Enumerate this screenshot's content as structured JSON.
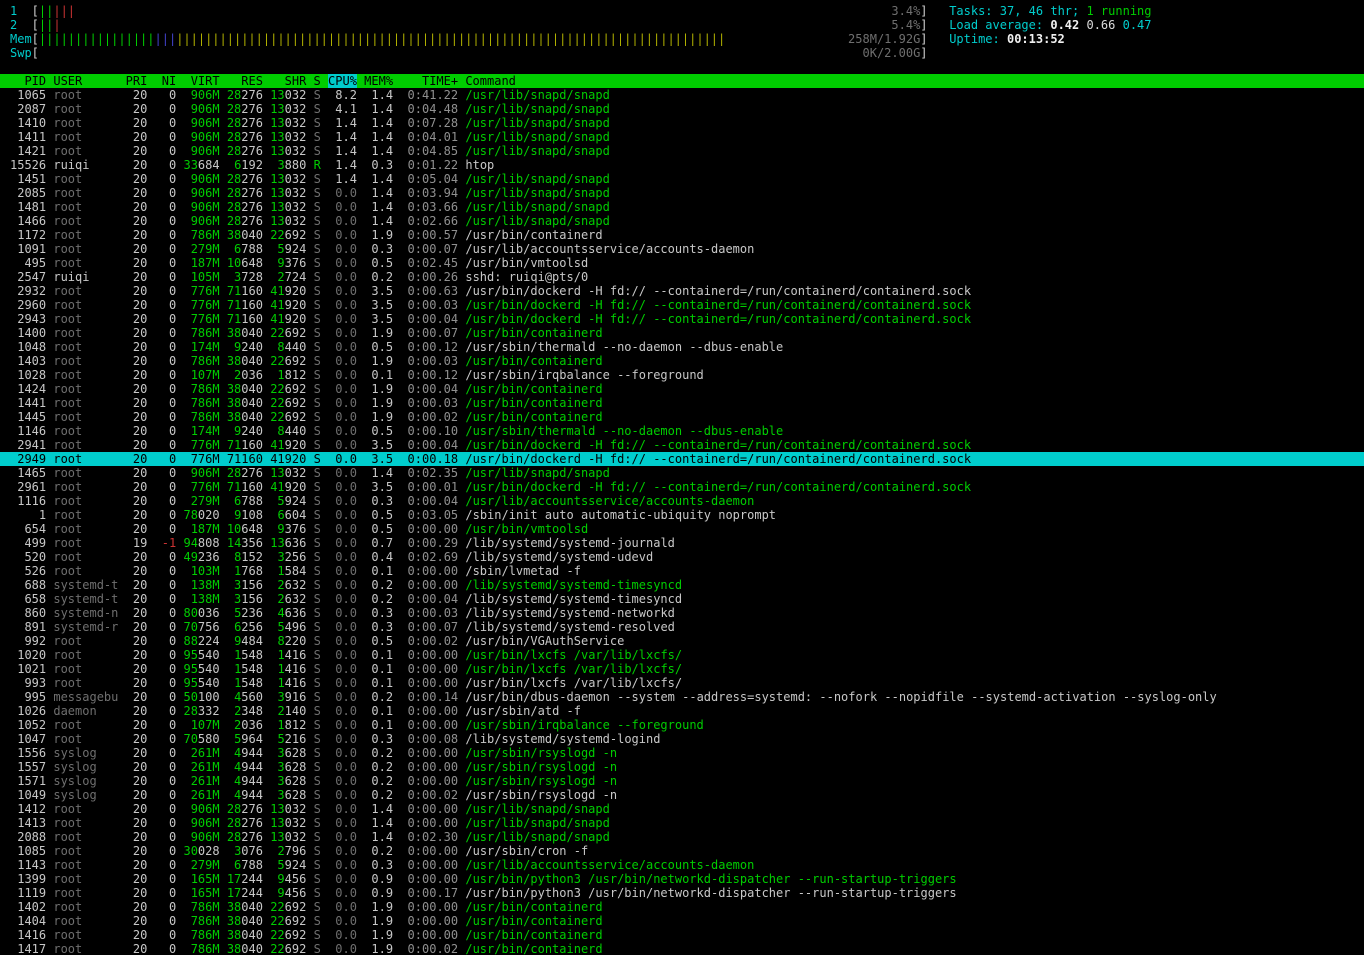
{
  "current_user": "ruiqi",
  "colors": {
    "green": "#00cd00",
    "cyan": "#00cdcd",
    "red": "#cc3333",
    "blue": "#4242cd",
    "yellow": "#b0b000",
    "norm": "#c8c8c8",
    "dim": "#6f6f6f",
    "time": "#909090",
    "meter_value": "#6f6f6f",
    "header_bg": "#00cd00",
    "selection_bg": "#00cdcd",
    "bright": "#f0f0f0",
    "white": "#dcdcdc"
  },
  "meters": {
    "bracket_open": "[",
    "bracket_close": "]",
    "cpu1": {
      "caption": "1",
      "value": "3.4%",
      "segments": [
        {
          "color": "#00cd00",
          "count": 2
        },
        {
          "color": "#cc3333",
          "count": 3
        }
      ]
    },
    "cpu2": {
      "caption": "2",
      "value": "5.4%",
      "segments": [
        {
          "color": "#00cd00",
          "count": 2
        },
        {
          "color": "#cc3333",
          "count": 1
        }
      ]
    },
    "mem": {
      "caption": "Mem",
      "value": "258M/1.92G",
      "segments": [
        {
          "color": "#00cd00",
          "count": 16
        },
        {
          "color": "#4242cd",
          "count": 3
        },
        {
          "color": "#b0b000",
          "count": 76
        }
      ]
    },
    "swp": {
      "caption": "Swp",
      "value": "0K/2.00G",
      "segments": []
    }
  },
  "summary": {
    "tasks_label": "Tasks: ",
    "tasks_value": "37, 46 thr; ",
    "tasks_running": "1 running",
    "load_label": "Load average: ",
    "load_1": "0.42 ",
    "load_5": "0.66 ",
    "load_15": "0.47",
    "uptime_label": "Uptime: ",
    "uptime_value": "00:13:52"
  },
  "table": {
    "sort_key": "cpu",
    "selected_pid": 2949,
    "columns": [
      {
        "key": "pid",
        "label": "PID",
        "width": 5,
        "align": "right"
      },
      {
        "key": "user",
        "label": "USER",
        "width": 9,
        "align": "left"
      },
      {
        "key": "pri",
        "label": "PRI",
        "width": 3,
        "align": "right"
      },
      {
        "key": "ni",
        "label": "NI",
        "width": 3,
        "align": "right"
      },
      {
        "key": "virt",
        "label": "VIRT",
        "width": 5,
        "align": "right"
      },
      {
        "key": "res",
        "label": "RES",
        "width": 5,
        "align": "right"
      },
      {
        "key": "shr",
        "label": "SHR",
        "width": 5,
        "align": "right"
      },
      {
        "key": "s",
        "label": "S",
        "width": 1,
        "align": "left"
      },
      {
        "key": "cpu",
        "label": "CPU%",
        "width": 4,
        "align": "right"
      },
      {
        "key": "mem",
        "label": "MEM%",
        "width": 4,
        "align": "right"
      },
      {
        "key": "time",
        "label": "TIME+",
        "width": 8,
        "align": "right"
      },
      {
        "key": "command",
        "label": "Command",
        "width": 0,
        "align": "left"
      }
    ],
    "processes": [
      [
        1065,
        "root",
        "20",
        "0",
        "906M",
        "28276",
        "13032",
        "S",
        "8.2",
        "1.4",
        "0:41.22",
        "/usr/lib/snapd/snapd",
        1
      ],
      [
        2087,
        "root",
        "20",
        "0",
        "906M",
        "28276",
        "13032",
        "S",
        "4.1",
        "1.4",
        "0:04.48",
        "/usr/lib/snapd/snapd",
        1
      ],
      [
        1410,
        "root",
        "20",
        "0",
        "906M",
        "28276",
        "13032",
        "S",
        "1.4",
        "1.4",
        "0:07.28",
        "/usr/lib/snapd/snapd",
        1
      ],
      [
        1411,
        "root",
        "20",
        "0",
        "906M",
        "28276",
        "13032",
        "S",
        "1.4",
        "1.4",
        "0:04.01",
        "/usr/lib/snapd/snapd",
        1
      ],
      [
        1421,
        "root",
        "20",
        "0",
        "906M",
        "28276",
        "13032",
        "S",
        "1.4",
        "1.4",
        "0:04.85",
        "/usr/lib/snapd/snapd",
        1
      ],
      [
        15526,
        "ruiqi",
        "20",
        "0",
        "33684",
        "6192",
        "3880",
        "R",
        "1.4",
        "0.3",
        "0:01.22",
        "htop",
        0
      ],
      [
        1451,
        "root",
        "20",
        "0",
        "906M",
        "28276",
        "13032",
        "S",
        "1.4",
        "1.4",
        "0:05.04",
        "/usr/lib/snapd/snapd",
        1
      ],
      [
        2085,
        "root",
        "20",
        "0",
        "906M",
        "28276",
        "13032",
        "S",
        "0.0",
        "1.4",
        "0:03.94",
        "/usr/lib/snapd/snapd",
        1
      ],
      [
        1481,
        "root",
        "20",
        "0",
        "906M",
        "28276",
        "13032",
        "S",
        "0.0",
        "1.4",
        "0:03.66",
        "/usr/lib/snapd/snapd",
        1
      ],
      [
        1466,
        "root",
        "20",
        "0",
        "906M",
        "28276",
        "13032",
        "S",
        "0.0",
        "1.4",
        "0:02.66",
        "/usr/lib/snapd/snapd",
        1
      ],
      [
        1172,
        "root",
        "20",
        "0",
        "786M",
        "38040",
        "22692",
        "S",
        "0.0",
        "1.9",
        "0:00.57",
        "/usr/bin/containerd",
        0
      ],
      [
        1091,
        "root",
        "20",
        "0",
        "279M",
        "6788",
        "5924",
        "S",
        "0.0",
        "0.3",
        "0:00.07",
        "/usr/lib/accountsservice/accounts-daemon",
        0
      ],
      [
        495,
        "root",
        "20",
        "0",
        "187M",
        "10648",
        "9376",
        "S",
        "0.0",
        "0.5",
        "0:02.45",
        "/usr/bin/vmtoolsd",
        0
      ],
      [
        2547,
        "ruiqi",
        "20",
        "0",
        "105M",
        "3728",
        "2724",
        "S",
        "0.0",
        "0.2",
        "0:00.26",
        "sshd: ruiqi@pts/0",
        0
      ],
      [
        2932,
        "root",
        "20",
        "0",
        "776M",
        "71160",
        "41920",
        "S",
        "0.0",
        "3.5",
        "0:00.63",
        "/usr/bin/dockerd -H fd:// --containerd=/run/containerd/containerd.sock",
        0
      ],
      [
        2960,
        "root",
        "20",
        "0",
        "776M",
        "71160",
        "41920",
        "S",
        "0.0",
        "3.5",
        "0:00.03",
        "/usr/bin/dockerd -H fd:// --containerd=/run/containerd/containerd.sock",
        1
      ],
      [
        2943,
        "root",
        "20",
        "0",
        "776M",
        "71160",
        "41920",
        "S",
        "0.0",
        "3.5",
        "0:00.04",
        "/usr/bin/dockerd -H fd:// --containerd=/run/containerd/containerd.sock",
        1
      ],
      [
        1400,
        "root",
        "20",
        "0",
        "786M",
        "38040",
        "22692",
        "S",
        "0.0",
        "1.9",
        "0:00.07",
        "/usr/bin/containerd",
        1
      ],
      [
        1048,
        "root",
        "20",
        "0",
        "174M",
        "9240",
        "8440",
        "S",
        "0.0",
        "0.5",
        "0:00.12",
        "/usr/sbin/thermald --no-daemon --dbus-enable",
        0
      ],
      [
        1403,
        "root",
        "20",
        "0",
        "786M",
        "38040",
        "22692",
        "S",
        "0.0",
        "1.9",
        "0:00.03",
        "/usr/bin/containerd",
        1
      ],
      [
        1028,
        "root",
        "20",
        "0",
        "107M",
        "2036",
        "1812",
        "S",
        "0.0",
        "0.1",
        "0:00.12",
        "/usr/sbin/irqbalance --foreground",
        0
      ],
      [
        1424,
        "root",
        "20",
        "0",
        "786M",
        "38040",
        "22692",
        "S",
        "0.0",
        "1.9",
        "0:00.04",
        "/usr/bin/containerd",
        1
      ],
      [
        1441,
        "root",
        "20",
        "0",
        "786M",
        "38040",
        "22692",
        "S",
        "0.0",
        "1.9",
        "0:00.03",
        "/usr/bin/containerd",
        1
      ],
      [
        1445,
        "root",
        "20",
        "0",
        "786M",
        "38040",
        "22692",
        "S",
        "0.0",
        "1.9",
        "0:00.02",
        "/usr/bin/containerd",
        1
      ],
      [
        1146,
        "root",
        "20",
        "0",
        "174M",
        "9240",
        "8440",
        "S",
        "0.0",
        "0.5",
        "0:00.10",
        "/usr/sbin/thermald --no-daemon --dbus-enable",
        1
      ],
      [
        2941,
        "root",
        "20",
        "0",
        "776M",
        "71160",
        "41920",
        "S",
        "0.0",
        "3.5",
        "0:00.04",
        "/usr/bin/dockerd -H fd:// --containerd=/run/containerd/containerd.sock",
        1
      ],
      [
        2949,
        "root",
        "20",
        "0",
        "776M",
        "71160",
        "41920",
        "S",
        "0.0",
        "3.5",
        "0:00.18",
        "/usr/bin/dockerd -H fd:// --containerd=/run/containerd/containerd.sock",
        1
      ],
      [
        1465,
        "root",
        "20",
        "0",
        "906M",
        "28276",
        "13032",
        "S",
        "0.0",
        "1.4",
        "0:02.35",
        "/usr/lib/snapd/snapd",
        1
      ],
      [
        2961,
        "root",
        "20",
        "0",
        "776M",
        "71160",
        "41920",
        "S",
        "0.0",
        "3.5",
        "0:00.01",
        "/usr/bin/dockerd -H fd:// --containerd=/run/containerd/containerd.sock",
        1
      ],
      [
        1116,
        "root",
        "20",
        "0",
        "279M",
        "6788",
        "5924",
        "S",
        "0.0",
        "0.3",
        "0:00.04",
        "/usr/lib/accountsservice/accounts-daemon",
        1
      ],
      [
        1,
        "root",
        "20",
        "0",
        "78020",
        "9108",
        "6604",
        "S",
        "0.0",
        "0.5",
        "0:03.05",
        "/sbin/init auto automatic-ubiquity noprompt",
        0
      ],
      [
        654,
        "root",
        "20",
        "0",
        "187M",
        "10648",
        "9376",
        "S",
        "0.0",
        "0.5",
        "0:00.00",
        "/usr/bin/vmtoolsd",
        1
      ],
      [
        499,
        "root",
        "19",
        "-1",
        "94808",
        "14356",
        "13636",
        "S",
        "0.0",
        "0.7",
        "0:00.29",
        "/lib/systemd/systemd-journald",
        0
      ],
      [
        520,
        "root",
        "20",
        "0",
        "49236",
        "8152",
        "3256",
        "S",
        "0.0",
        "0.4",
        "0:02.69",
        "/lib/systemd/systemd-udevd",
        0
      ],
      [
        526,
        "root",
        "20",
        "0",
        "103M",
        "1768",
        "1584",
        "S",
        "0.0",
        "0.1",
        "0:00.00",
        "/sbin/lvmetad -f",
        0
      ],
      [
        688,
        "systemd-t",
        "20",
        "0",
        "138M",
        "3156",
        "2632",
        "S",
        "0.0",
        "0.2",
        "0:00.00",
        "/lib/systemd/systemd-timesyncd",
        1
      ],
      [
        658,
        "systemd-t",
        "20",
        "0",
        "138M",
        "3156",
        "2632",
        "S",
        "0.0",
        "0.2",
        "0:00.04",
        "/lib/systemd/systemd-timesyncd",
        0
      ],
      [
        860,
        "systemd-n",
        "20",
        "0",
        "80036",
        "5236",
        "4636",
        "S",
        "0.0",
        "0.3",
        "0:00.03",
        "/lib/systemd/systemd-networkd",
        0
      ],
      [
        891,
        "systemd-r",
        "20",
        "0",
        "70756",
        "6256",
        "5496",
        "S",
        "0.0",
        "0.3",
        "0:00.07",
        "/lib/systemd/systemd-resolved",
        0
      ],
      [
        992,
        "root",
        "20",
        "0",
        "88224",
        "9484",
        "8220",
        "S",
        "0.0",
        "0.5",
        "0:00.02",
        "/usr/bin/VGAuthService",
        0
      ],
      [
        1020,
        "root",
        "20",
        "0",
        "95540",
        "1548",
        "1416",
        "S",
        "0.0",
        "0.1",
        "0:00.00",
        "/usr/bin/lxcfs /var/lib/lxcfs/",
        1
      ],
      [
        1021,
        "root",
        "20",
        "0",
        "95540",
        "1548",
        "1416",
        "S",
        "0.0",
        "0.1",
        "0:00.00",
        "/usr/bin/lxcfs /var/lib/lxcfs/",
        1
      ],
      [
        993,
        "root",
        "20",
        "0",
        "95540",
        "1548",
        "1416",
        "S",
        "0.0",
        "0.1",
        "0:00.00",
        "/usr/bin/lxcfs /var/lib/lxcfs/",
        0
      ],
      [
        995,
        "messagebu",
        "20",
        "0",
        "50100",
        "4560",
        "3916",
        "S",
        "0.0",
        "0.2",
        "0:00.14",
        "/usr/bin/dbus-daemon --system --address=systemd: --nofork --nopidfile --systemd-activation --syslog-only",
        0
      ],
      [
        1026,
        "daemon",
        "20",
        "0",
        "28332",
        "2348",
        "2140",
        "S",
        "0.0",
        "0.1",
        "0:00.00",
        "/usr/sbin/atd -f",
        0
      ],
      [
        1052,
        "root",
        "20",
        "0",
        "107M",
        "2036",
        "1812",
        "S",
        "0.0",
        "0.1",
        "0:00.00",
        "/usr/sbin/irqbalance --foreground",
        1
      ],
      [
        1047,
        "root",
        "20",
        "0",
        "70580",
        "5964",
        "5216",
        "S",
        "0.0",
        "0.3",
        "0:00.08",
        "/lib/systemd/systemd-logind",
        0
      ],
      [
        1556,
        "syslog",
        "20",
        "0",
        "261M",
        "4944",
        "3628",
        "S",
        "0.0",
        "0.2",
        "0:00.00",
        "/usr/sbin/rsyslogd -n",
        1
      ],
      [
        1557,
        "syslog",
        "20",
        "0",
        "261M",
        "4944",
        "3628",
        "S",
        "0.0",
        "0.2",
        "0:00.00",
        "/usr/sbin/rsyslogd -n",
        1
      ],
      [
        1571,
        "syslog",
        "20",
        "0",
        "261M",
        "4944",
        "3628",
        "S",
        "0.0",
        "0.2",
        "0:00.00",
        "/usr/sbin/rsyslogd -n",
        1
      ],
      [
        1049,
        "syslog",
        "20",
        "0",
        "261M",
        "4944",
        "3628",
        "S",
        "0.0",
        "0.2",
        "0:00.02",
        "/usr/sbin/rsyslogd -n",
        0
      ],
      [
        1412,
        "root",
        "20",
        "0",
        "906M",
        "28276",
        "13032",
        "S",
        "0.0",
        "1.4",
        "0:00.00",
        "/usr/lib/snapd/snapd",
        1
      ],
      [
        1413,
        "root",
        "20",
        "0",
        "906M",
        "28276",
        "13032",
        "S",
        "0.0",
        "1.4",
        "0:00.00",
        "/usr/lib/snapd/snapd",
        1
      ],
      [
        2088,
        "root",
        "20",
        "0",
        "906M",
        "28276",
        "13032",
        "S",
        "0.0",
        "1.4",
        "0:02.30",
        "/usr/lib/snapd/snapd",
        1
      ],
      [
        1085,
        "root",
        "20",
        "0",
        "30028",
        "3076",
        "2796",
        "S",
        "0.0",
        "0.2",
        "0:00.00",
        "/usr/sbin/cron -f",
        0
      ],
      [
        1143,
        "root",
        "20",
        "0",
        "279M",
        "6788",
        "5924",
        "S",
        "0.0",
        "0.3",
        "0:00.00",
        "/usr/lib/accountsservice/accounts-daemon",
        1
      ],
      [
        1399,
        "root",
        "20",
        "0",
        "165M",
        "17244",
        "9456",
        "S",
        "0.0",
        "0.9",
        "0:00.00",
        "/usr/bin/python3 /usr/bin/networkd-dispatcher --run-startup-triggers",
        1
      ],
      [
        1119,
        "root",
        "20",
        "0",
        "165M",
        "17244",
        "9456",
        "S",
        "0.0",
        "0.9",
        "0:00.17",
        "/usr/bin/python3 /usr/bin/networkd-dispatcher --run-startup-triggers",
        0
      ],
      [
        1402,
        "root",
        "20",
        "0",
        "786M",
        "38040",
        "22692",
        "S",
        "0.0",
        "1.9",
        "0:00.00",
        "/usr/bin/containerd",
        1
      ],
      [
        1404,
        "root",
        "20",
        "0",
        "786M",
        "38040",
        "22692",
        "S",
        "0.0",
        "1.9",
        "0:00.00",
        "/usr/bin/containerd",
        1
      ],
      [
        1416,
        "root",
        "20",
        "0",
        "786M",
        "38040",
        "22692",
        "S",
        "0.0",
        "1.9",
        "0:00.00",
        "/usr/bin/containerd",
        1
      ],
      [
        1417,
        "root",
        "20",
        "0",
        "786M",
        "38040",
        "22692",
        "S",
        "0.0",
        "1.9",
        "0:00.02",
        "/usr/bin/containerd",
        1
      ]
    ]
  }
}
